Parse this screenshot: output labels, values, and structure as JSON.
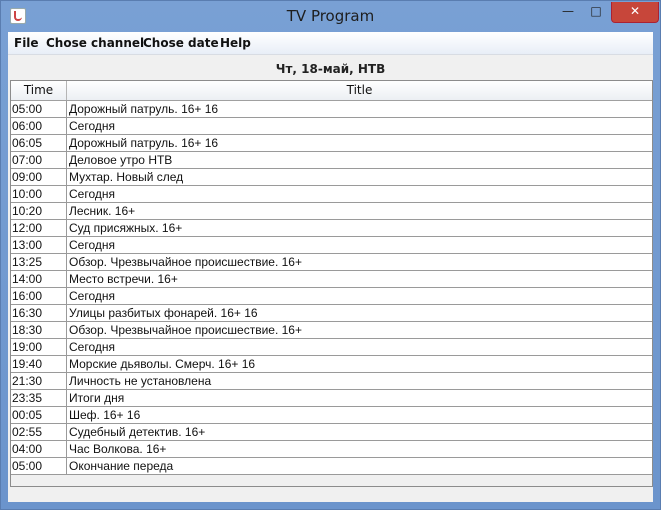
{
  "window": {
    "title": "TV Program",
    "minimize_glyph": "—",
    "maximize_glyph": "□",
    "close_glyph": "✕"
  },
  "menu": [
    "File",
    "Chose channel",
    "Chose date",
    "Help"
  ],
  "header": {
    "channel_date": "Чт, 18-май, НТВ"
  },
  "table": {
    "columns": [
      "Time",
      "Title"
    ],
    "rows": [
      [
        "05:00",
        "Дорожный патруль. 16+ 16"
      ],
      [
        "06:00",
        "Сегодня"
      ],
      [
        "06:05",
        "Дорожный патруль. 16+ 16"
      ],
      [
        "07:00",
        "Деловое утро НТВ"
      ],
      [
        "09:00",
        "Мухтар. Новый след"
      ],
      [
        "10:00",
        "Сегодня"
      ],
      [
        "10:20",
        "Лесник. 16+"
      ],
      [
        "12:00",
        "Суд присяжных. 16+"
      ],
      [
        "13:00",
        "Сегодня"
      ],
      [
        "13:25",
        "Обзор. Чрезвычайное происшествие. 16+"
      ],
      [
        "14:00",
        "Место встречи. 16+"
      ],
      [
        "16:00",
        "Сегодня"
      ],
      [
        "16:30",
        "Улицы разбитых фонарей. 16+ 16"
      ],
      [
        "18:30",
        "Обзор. Чрезвычайное происшествие. 16+"
      ],
      [
        "19:00",
        "Сегодня"
      ],
      [
        "19:40",
        "Морские дьяволы. Смерч. 16+ 16"
      ],
      [
        "21:30",
        "Личность не установлена"
      ],
      [
        "23:35",
        "Итоги дня"
      ],
      [
        "00:05",
        "Шеф. 16+ 16"
      ],
      [
        "02:55",
        "Судебный детектив. 16+"
      ],
      [
        "04:00",
        "Час Волкова. 16+"
      ],
      [
        "05:00",
        "Окончание переда"
      ]
    ]
  }
}
